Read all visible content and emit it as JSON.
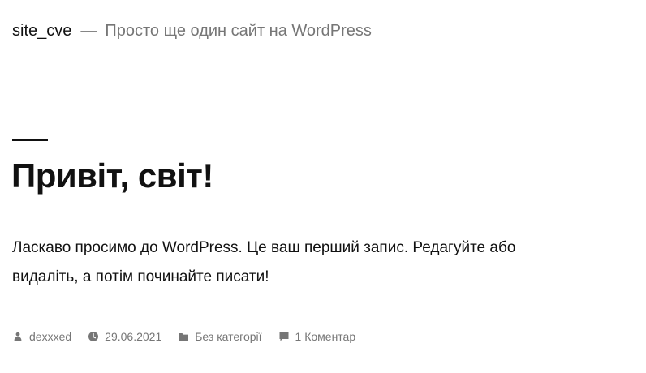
{
  "header": {
    "site_title": "site_cve",
    "separator": "—",
    "description": "Просто ще один сайт на WordPress"
  },
  "post": {
    "title": "Привіт, світ!",
    "content": "Ласкаво просимо до WordPress. Це ваш перший запис. Редагуйте або видаліть, а потім починайте писати!",
    "meta": {
      "author": "dexxxed",
      "date": "29.06.2021",
      "category": "Без категорії",
      "comments": "1 Коментар"
    }
  },
  "icons": {
    "author": "person-icon",
    "date": "clock-icon",
    "category": "folder-icon",
    "comments": "comment-icon"
  },
  "colors": {
    "text": "#111111",
    "muted": "#767676",
    "background": "#ffffff"
  }
}
